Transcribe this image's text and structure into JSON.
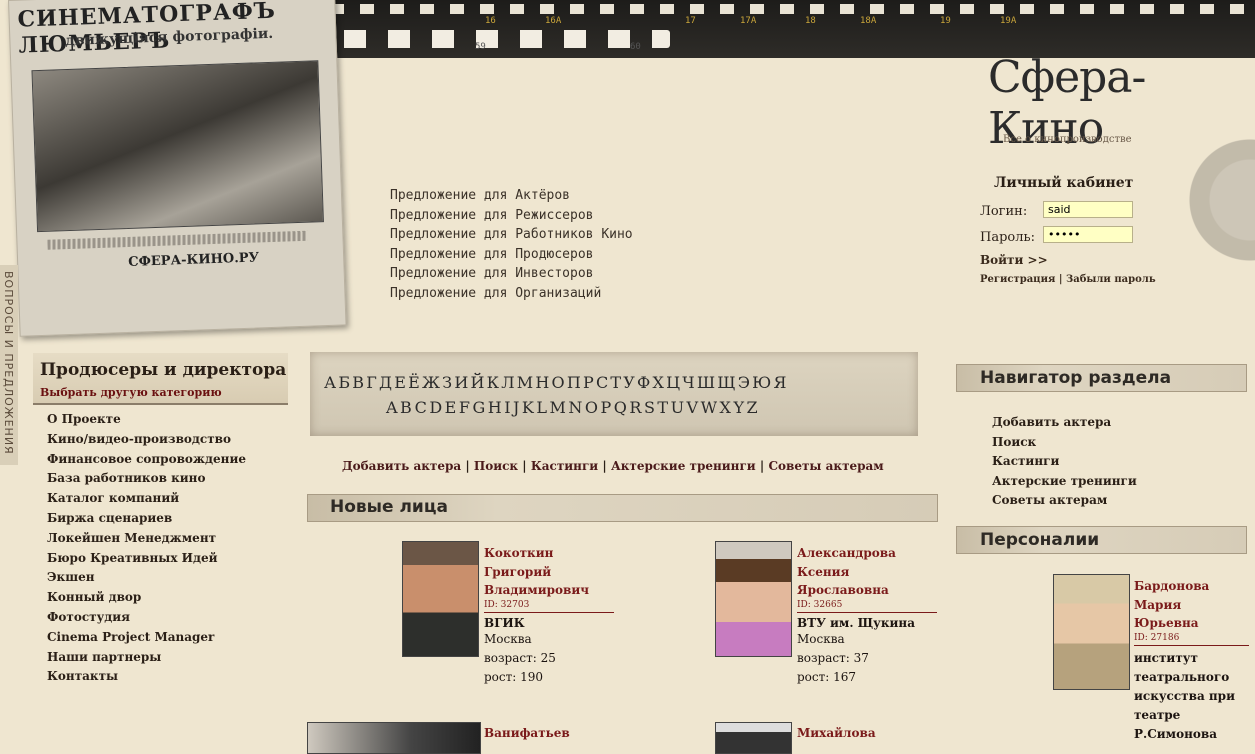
{
  "side_tab": {
    "label": "ВОПРОСЫ И ПРЕДЛОЖЕНИЯ"
  },
  "newspaper": {
    "title": "СИНЕМАТОГРАФЪ ЛЮМЬЕРЪ",
    "subtitle": "движущіяся фотографіи.",
    "brand": "СФЕРА-КИНО.РУ"
  },
  "filmstrip": {
    "numbers": [
      "59",
      "60",
      "16",
      "16A",
      "17",
      "17A",
      "18",
      "18A",
      "19",
      "19A"
    ]
  },
  "logo": {
    "title": "Сфера-Кино",
    "tagline": "Все о кинопроизводстве"
  },
  "login": {
    "title": "Личный кабинет",
    "login_label": "Логин:",
    "login_value": "said",
    "password_label": "Пароль:",
    "password_value": "•••••",
    "enter": "Войти >>",
    "register": "Регистрация",
    "separator": " | ",
    "forgot": "Забыли пароль"
  },
  "offers": [
    "Предложение для Актёров",
    "Предложение для Режиссеров",
    "Предложение для Работников Кино",
    "Предложение для Продюсеров",
    "Предложение для Инвесторов",
    "Предложение для Организаций"
  ],
  "category": {
    "title": "Продюсеры и директора",
    "change": "Выбрать другую категорию"
  },
  "left_menu": [
    "О Проекте",
    "Кино/видео-производство",
    "Финансовое сопровождение",
    "База работников кино",
    "Каталог компаний",
    "Биржа сценариев",
    "Локейшен Менеджмент",
    "Бюро Креативных Идей",
    "Экшен",
    "Конный двор",
    "Фотостудия",
    "Cinema Project Manager",
    "Наши партнеры",
    "Контакты"
  ],
  "alphabet": {
    "ru": "АБВГДЕЁЖЗИЙКЛМНОПРСТУФХЦЧШЩЭЮЯ",
    "en": "ABCDEFGHIJKLMNOPQRSTUVWXYZ"
  },
  "sub_nav": [
    "Добавить актера",
    "Поиск",
    "Кастинги",
    "Актерские тренинги",
    "Советы актерам"
  ],
  "sub_nav_sep": " | ",
  "new_faces": {
    "title": "Новые лица",
    "cards": [
      {
        "name": [
          "Кокоткин",
          "Григорий",
          "Владимирович"
        ],
        "id": "ID: 32703",
        "school": "ВГИК",
        "city": "Москва",
        "age": "возраст: 25",
        "height": "рост: 190"
      },
      {
        "name": [
          "Александрова",
          "Ксения",
          "Ярославовна"
        ],
        "id": "ID: 32665",
        "school": "ВТУ им. Щукина",
        "city": "Москва",
        "age": "возраст: 37",
        "height": "рост: 167"
      },
      {
        "name": [
          "Ванифатьев"
        ]
      },
      {
        "name": [
          "Михайлова"
        ]
      }
    ]
  },
  "navigator": {
    "title": "Навигатор раздела",
    "items": [
      "Добавить актера",
      "Поиск",
      "Кастинги",
      "Актерские тренинги",
      "Советы актерам"
    ]
  },
  "personalia": {
    "title": "Персоналии",
    "card": {
      "name": [
        "Бардонова",
        "Мария",
        "Юрьевна"
      ],
      "id": "ID: 27186",
      "info": [
        "институт",
        "театрального",
        "искусства при",
        "театре",
        "Р.Симонова"
      ]
    }
  },
  "colors": {
    "background": "#efe6d0",
    "link_dark": "#7a1a1a",
    "input_bg": "#ffffc4"
  }
}
